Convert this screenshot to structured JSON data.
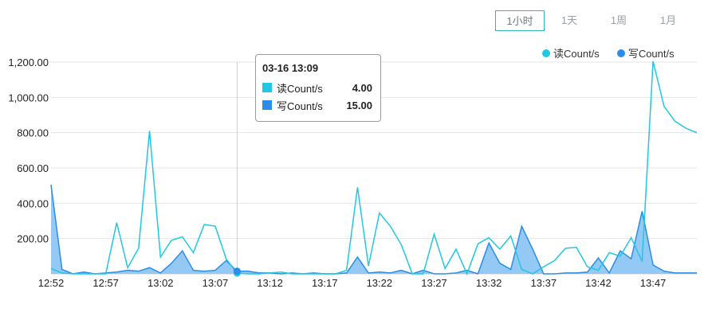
{
  "range_tabs": [
    {
      "label": "1小时",
      "active": true
    },
    {
      "label": "1天",
      "active": false
    },
    {
      "label": "1周",
      "active": false
    },
    {
      "label": "1月",
      "active": false
    }
  ],
  "colors": {
    "read": "#1fc8e3",
    "write": "#2a8ee8",
    "write_fill": "#8fc6f4",
    "grid": "#e6e6e6",
    "crosshair": "#cccccc"
  },
  "tooltip": {
    "title": "03-16 13:09",
    "rows": [
      {
        "name": "读Count/s",
        "value": "4.00"
      },
      {
        "name": "写Count/s",
        "value": "15.00"
      }
    ]
  },
  "chart_data": {
    "type": "area",
    "hover_index": 17,
    "x": [
      "12:52",
      "12:53",
      "12:54",
      "12:55",
      "12:56",
      "12:57",
      "12:58",
      "12:59",
      "13:00",
      "13:01",
      "13:02",
      "13:03",
      "13:04",
      "13:05",
      "13:06",
      "13:07",
      "13:08",
      "13:09",
      "13:10",
      "13:11",
      "13:12",
      "13:13",
      "13:14",
      "13:15",
      "13:16",
      "13:17",
      "13:18",
      "13:19",
      "13:20",
      "13:21",
      "13:22",
      "13:23",
      "13:24",
      "13:25",
      "13:26",
      "13:27",
      "13:28",
      "13:29",
      "13:30",
      "13:31",
      "13:32",
      "13:33",
      "13:34",
      "13:35",
      "13:36",
      "13:37",
      "13:38",
      "13:39",
      "13:40",
      "13:41",
      "13:42",
      "13:43",
      "13:44",
      "13:45",
      "13:46",
      "13:47",
      "13:48",
      "13:49",
      "13:50",
      "13:51"
    ],
    "xticks": [
      "12:52",
      "12:57",
      "13:02",
      "13:07",
      "13:12",
      "13:17",
      "13:22",
      "13:27",
      "13:32",
      "13:37",
      "13:42",
      "13:47"
    ],
    "yticks": [
      "1,200.00",
      "1,000.00",
      "800.00",
      "600.00",
      "400.00",
      "200.00"
    ],
    "ylim": [
      0,
      1200
    ],
    "series": [
      {
        "name": "读Count/s",
        "kind": "line",
        "values": [
          30,
          5,
          0,
          0,
          0,
          0,
          290,
          35,
          145,
          810,
          95,
          190,
          210,
          120,
          280,
          270,
          85,
          4,
          0,
          0,
          5,
          10,
          0,
          0,
          0,
          0,
          0,
          20,
          490,
          45,
          345,
          270,
          165,
          0,
          0,
          225,
          30,
          140,
          0,
          170,
          205,
          140,
          215,
          25,
          0,
          40,
          75,
          145,
          150,
          40,
          20,
          120,
          100,
          205,
          70,
          1205,
          950,
          865,
          825,
          800
        ]
      },
      {
        "name": "写Count/s",
        "kind": "area",
        "values": [
          505,
          25,
          0,
          10,
          0,
          5,
          10,
          20,
          15,
          35,
          5,
          60,
          130,
          20,
          15,
          20,
          75,
          15,
          15,
          5,
          5,
          0,
          5,
          0,
          5,
          0,
          0,
          5,
          95,
          5,
          10,
          5,
          20,
          0,
          20,
          0,
          0,
          5,
          20,
          0,
          175,
          60,
          25,
          270,
          140,
          0,
          0,
          5,
          5,
          10,
          90,
          5,
          130,
          85,
          355,
          50,
          15,
          5,
          5,
          5
        ]
      }
    ]
  }
}
